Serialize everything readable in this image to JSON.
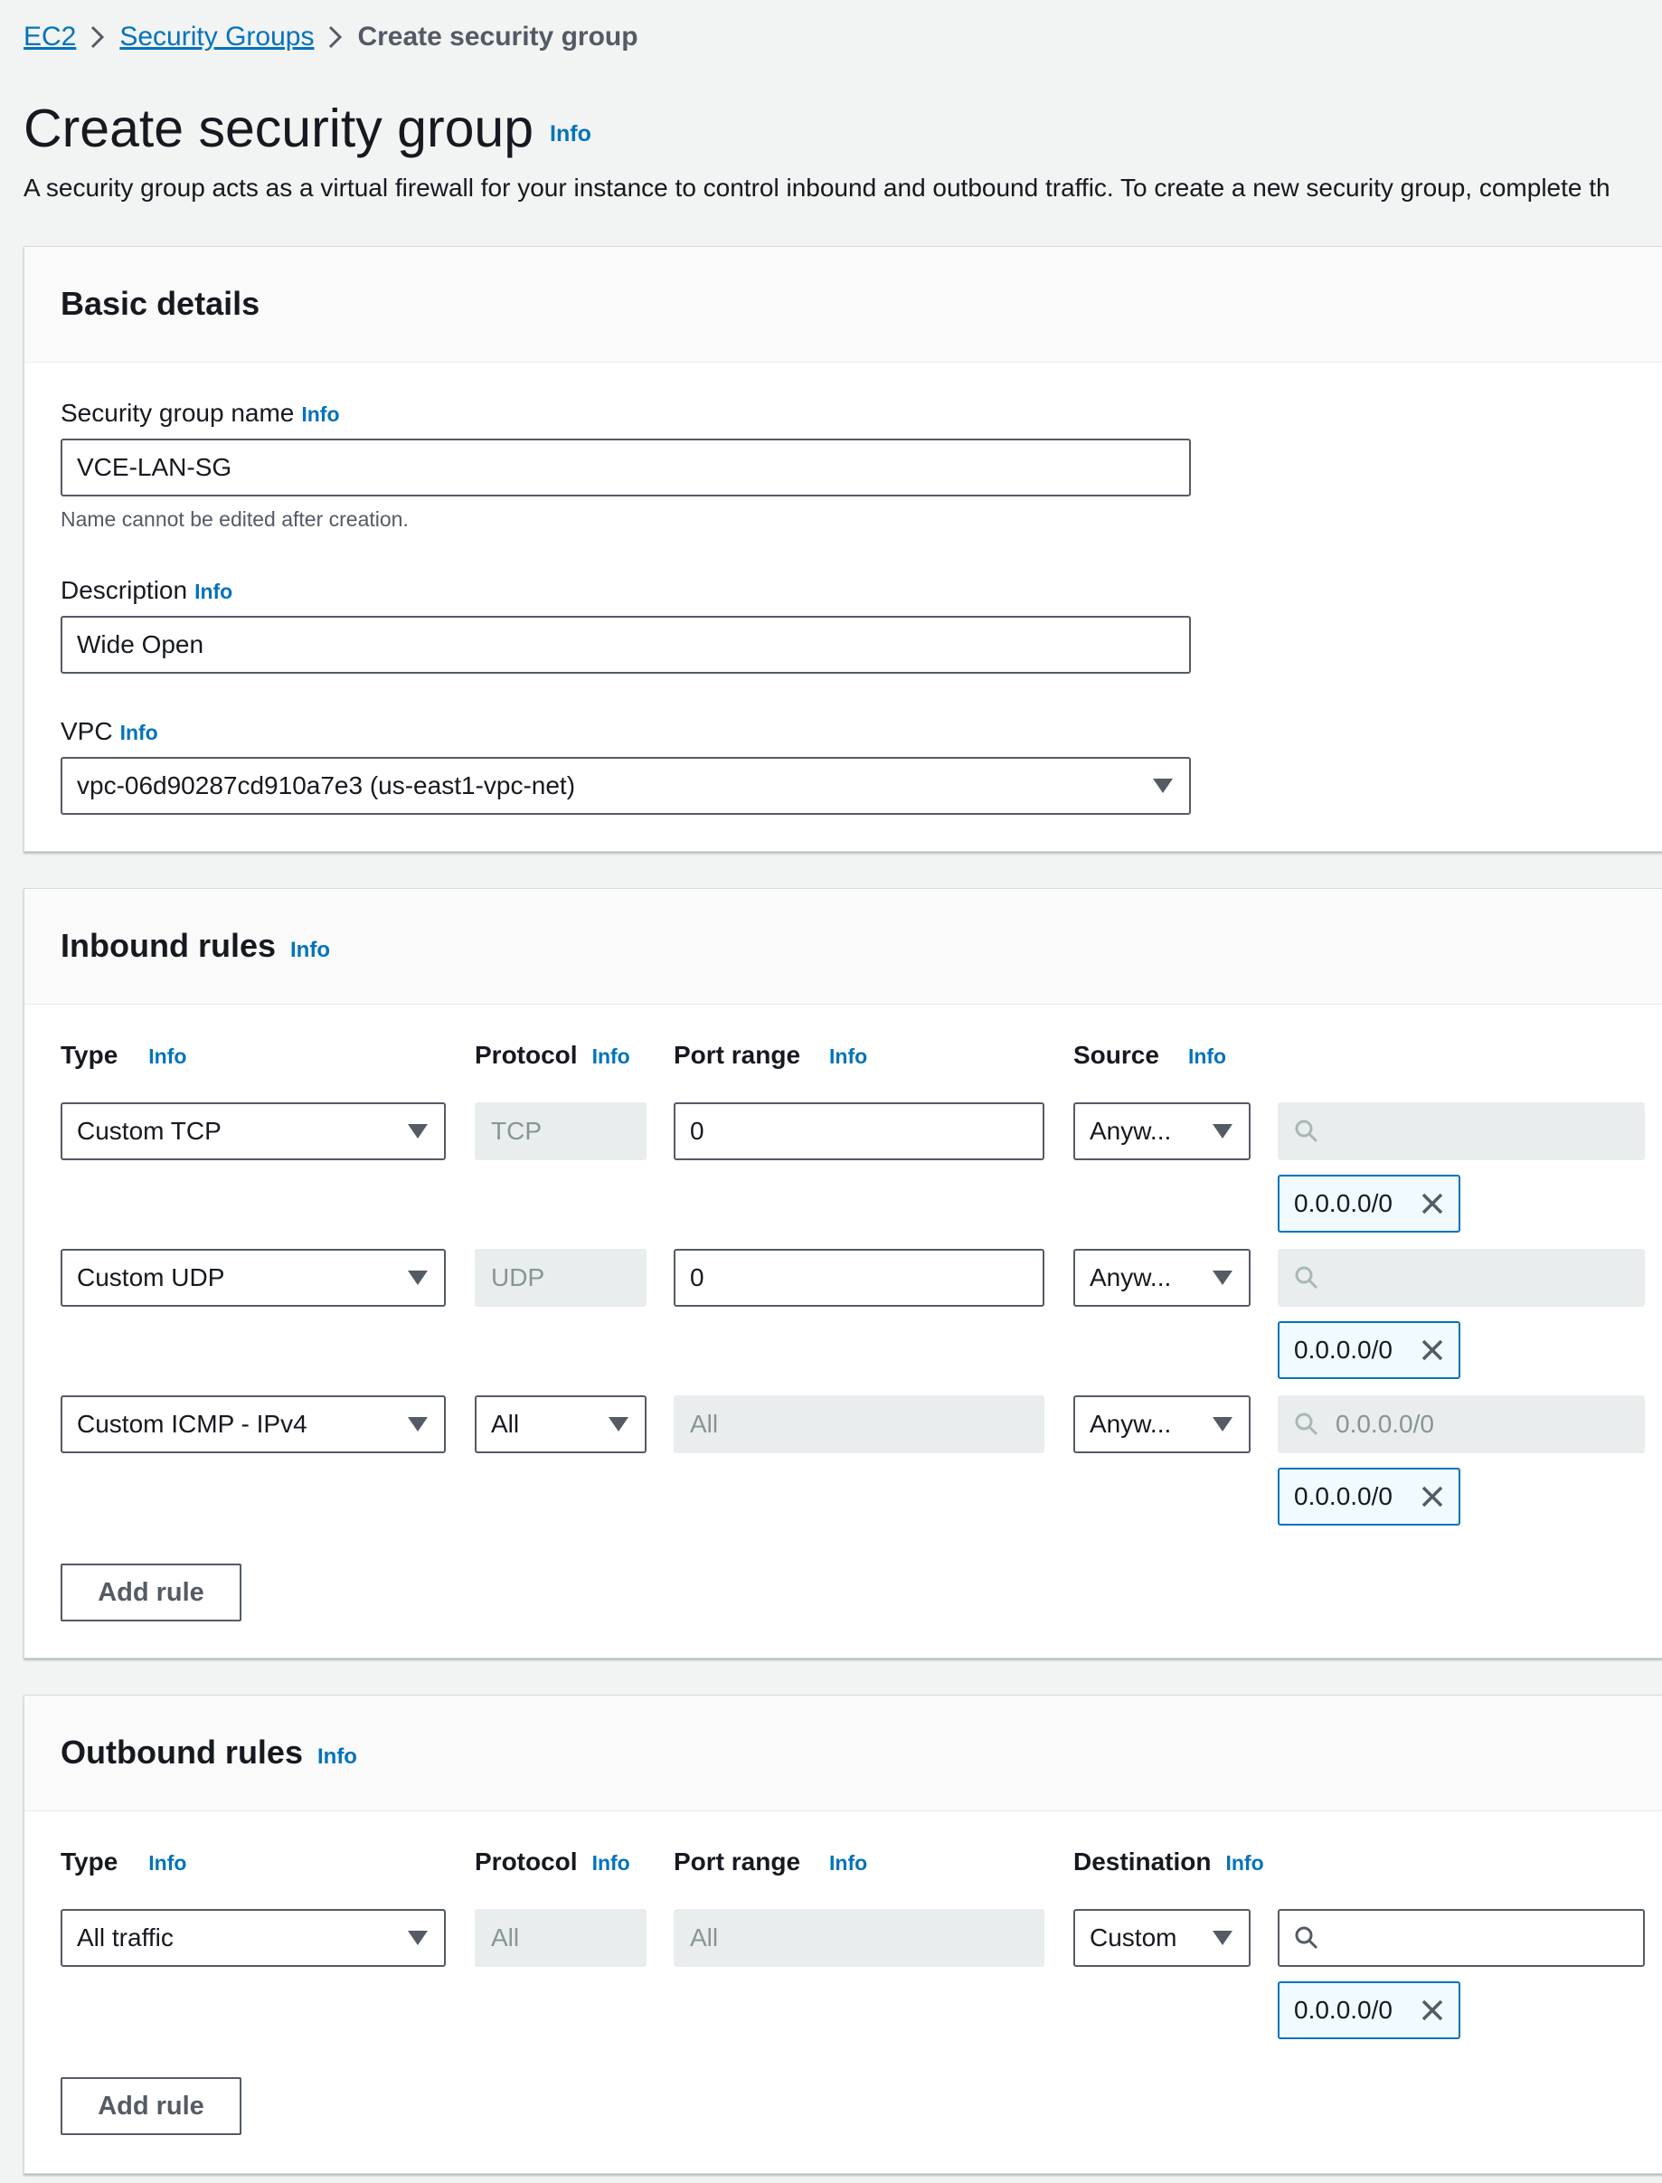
{
  "breadcrumb": {
    "items": [
      {
        "label": "EC2"
      },
      {
        "label": "Security Groups"
      },
      {
        "label": "Create security group"
      }
    ]
  },
  "page": {
    "title": "Create security group",
    "info": "Info",
    "description": "A security group acts as a virtual firewall for your instance to control inbound and outbound traffic. To create a new security group, complete th"
  },
  "basic": {
    "title": "Basic details",
    "name_label": "Security group name",
    "name_value": "VCE-LAN-SG",
    "name_hint": "Name cannot be edited after creation.",
    "desc_label": "Description",
    "desc_value": "Wide Open",
    "vpc_label": "VPC",
    "vpc_value": "vpc-06d90287cd910a7e3 (us-east1-vpc-net)"
  },
  "inbound": {
    "title": "Inbound rules",
    "columns": {
      "type": "Type",
      "protocol": "Protocol",
      "port": "Port range",
      "source": "Source"
    },
    "rows": [
      {
        "type": "Custom TCP",
        "protocol": "TCP",
        "port": "0",
        "source": "Anyw...",
        "search": "",
        "token": "0.0.0.0/0"
      },
      {
        "type": "Custom UDP",
        "protocol": "UDP",
        "port": "0",
        "source": "Anyw...",
        "search": "",
        "token": "0.0.0.0/0"
      },
      {
        "type": "Custom ICMP - IPv4",
        "protocol": "All",
        "port": "All",
        "source": "Anyw...",
        "search": "0.0.0.0/0",
        "token": "0.0.0.0/0"
      }
    ],
    "add_rule": "Add rule"
  },
  "outbound": {
    "title": "Outbound rules",
    "columns": {
      "type": "Type",
      "protocol": "Protocol",
      "port": "Port range",
      "destination": "Destination"
    },
    "rows": [
      {
        "type": "All traffic",
        "protocol": "All",
        "port": "All",
        "destination": "Custom",
        "search": "",
        "token": "0.0.0.0/0"
      }
    ],
    "add_rule": "Add rule"
  },
  "icons": {
    "breadcrumb_separator": "chevron-right-icon",
    "dropdown": "caret-down-icon",
    "search": "search-icon",
    "remove": "close-icon"
  },
  "colors": {
    "link": "#0073bb",
    "background": "#f2f3f3",
    "panel_header": "#fafafa",
    "disabled_field": "#eaeded",
    "token_bg": "#f1faff"
  }
}
